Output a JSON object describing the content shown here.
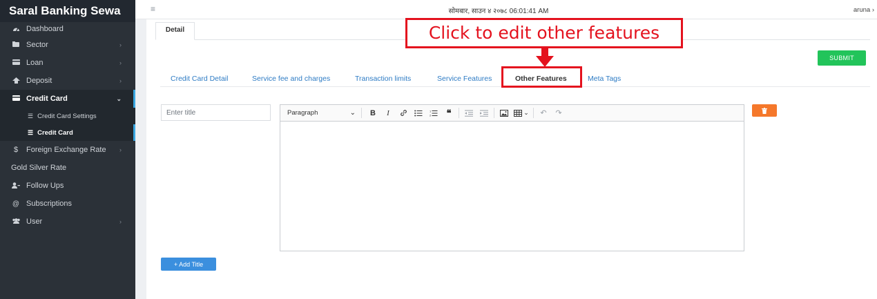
{
  "sidebar": {
    "brand": "Saral Banking Sewa",
    "items": [
      {
        "label": "Dashboard",
        "icon": "dashboard-icon",
        "has_chevron": false
      },
      {
        "label": "Sector",
        "icon": "folder-icon",
        "has_chevron": true
      },
      {
        "label": "Loan",
        "icon": "card-icon",
        "has_chevron": true
      },
      {
        "label": "Deposit",
        "icon": "deposit-icon",
        "has_chevron": true
      },
      {
        "label": "Credit Card",
        "icon": "credit-card-icon",
        "has_chevron": true,
        "expanded": true,
        "active": true
      },
      {
        "label": "Foreign Exchange Rate",
        "icon": "dollar-icon",
        "has_chevron": true
      },
      {
        "label": "Gold Silver Rate",
        "icon": "",
        "has_chevron": false
      },
      {
        "label": "Follow Ups",
        "icon": "follow-up-icon",
        "has_chevron": false
      },
      {
        "label": "Subscriptions",
        "icon": "at-icon",
        "has_chevron": false
      },
      {
        "label": "User",
        "icon": "users-icon",
        "has_chevron": true
      }
    ],
    "subitems": [
      {
        "label": "Credit Card Settings",
        "icon": "list-icon"
      },
      {
        "label": "Credit Card",
        "icon": "list-icon",
        "active": true
      }
    ]
  },
  "topbar": {
    "datetime": "सोमबार, साउन ४ २०७८ 06:01:41 AM",
    "user": "aruna"
  },
  "main": {
    "detail_tab": "Detail",
    "submit_label": "SUBMIT",
    "subtabs": [
      {
        "label": "Credit Card Detail",
        "active": false
      },
      {
        "label": "Service fee and charges",
        "active": false
      },
      {
        "label": "Transaction limits",
        "active": false
      },
      {
        "label": "Service Features",
        "active": false
      },
      {
        "label": "Other Features",
        "active": true
      },
      {
        "label": "Meta Tags",
        "active": false
      }
    ],
    "title_placeholder": "Enter title",
    "editor": {
      "format_select": "Paragraph"
    },
    "add_title_label": "+ Add Title"
  },
  "annotation": {
    "callout_text": "Click to edit other features",
    "color": "#e4121e"
  },
  "colors": {
    "sidebar_bg": "#2b3138",
    "accent_blue": "#2d7bc4",
    "submit_green": "#22c45a",
    "delete_orange": "#f5782b",
    "add_blue": "#3b8fde"
  }
}
